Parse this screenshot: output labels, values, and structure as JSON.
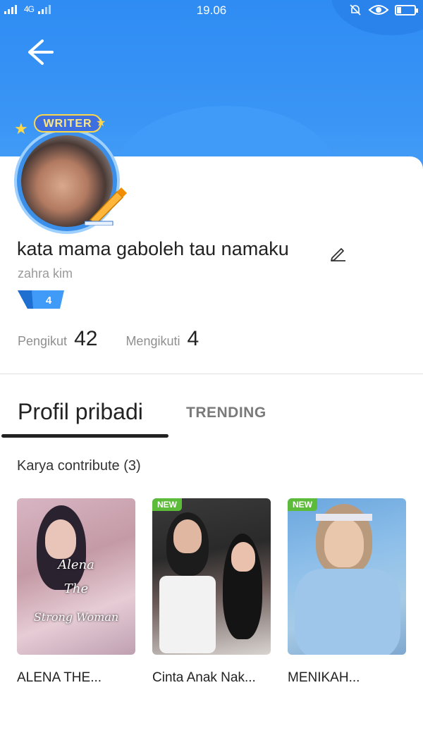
{
  "status_bar": {
    "left": "4G",
    "time": "19.06"
  },
  "profile": {
    "badge": "WRITER",
    "name": "kata mama gaboleh tau namaku",
    "username": "zahra kim",
    "level": "4",
    "followers_label": "Pengikut",
    "followers_count": "42",
    "following_label": "Mengikuti",
    "following_count": "4"
  },
  "tabs": [
    {
      "label": "Profil pribadi",
      "active": true
    },
    {
      "label": "TRENDING",
      "active": false
    }
  ],
  "section": {
    "title": "Karya contribute (3)"
  },
  "books": [
    {
      "title": "ALENA THE...",
      "badge": "",
      "cover_text": [
        "Alena",
        "The",
        "Strong Woman"
      ]
    },
    {
      "title": "Cinta Anak Nak...",
      "badge": "NEW"
    },
    {
      "title": "MENIKAH...",
      "badge": "NEW"
    }
  ],
  "colors": {
    "header_blue": "#2f8cf3",
    "new_badge": "#5dbb3a",
    "level_badge": "#2f8cf3"
  },
  "icons": [
    "back-arrow-icon",
    "edit-pencil-icon",
    "eye-icon",
    "bell-off-icon",
    "battery-icon",
    "signal-icon"
  ]
}
